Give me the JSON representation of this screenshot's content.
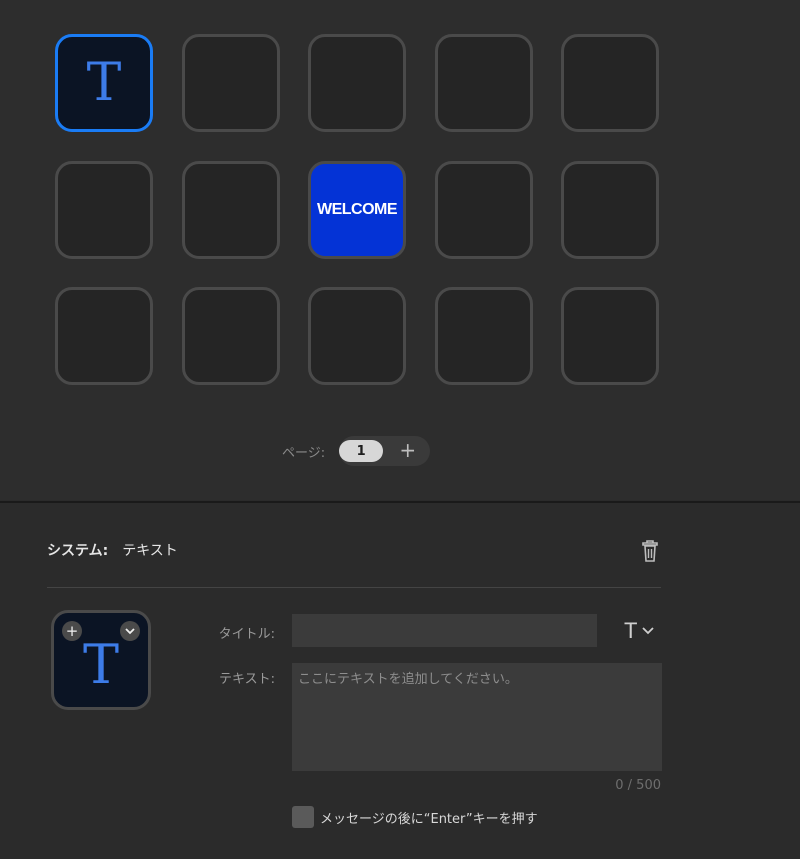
{
  "grid": {
    "keys": [
      {
        "type": "text-icon",
        "glyph": "T",
        "selected": true
      },
      {
        "type": "empty"
      },
      {
        "type": "empty"
      },
      {
        "type": "empty"
      },
      {
        "type": "empty"
      },
      {
        "type": "empty"
      },
      {
        "type": "empty"
      },
      {
        "type": "welcome",
        "label": "WELCOME"
      },
      {
        "type": "empty"
      },
      {
        "type": "empty"
      },
      {
        "type": "empty"
      },
      {
        "type": "empty"
      },
      {
        "type": "empty"
      },
      {
        "type": "empty"
      },
      {
        "type": "empty"
      }
    ]
  },
  "pager": {
    "label": "ページ:",
    "current": "1",
    "add": "+"
  },
  "action": {
    "category": "システム:",
    "name": "テキスト"
  },
  "preview": {
    "glyph": "T",
    "plus": "+",
    "chevron": "⌄"
  },
  "form": {
    "title_label": "タイトル:",
    "title_value": "",
    "font_glyph": "T",
    "text_label": "テキスト:",
    "text_placeholder": "ここにテキストを追加してください。",
    "counter": "0 / 500",
    "enter_checkbox_label": "メッセージの後に“Enter”キーを押す",
    "enter_checked": false
  },
  "colors": {
    "accent": "#1a7cf5",
    "welcome_bg": "#0433d6",
    "glyph": "#3d7ce8"
  }
}
